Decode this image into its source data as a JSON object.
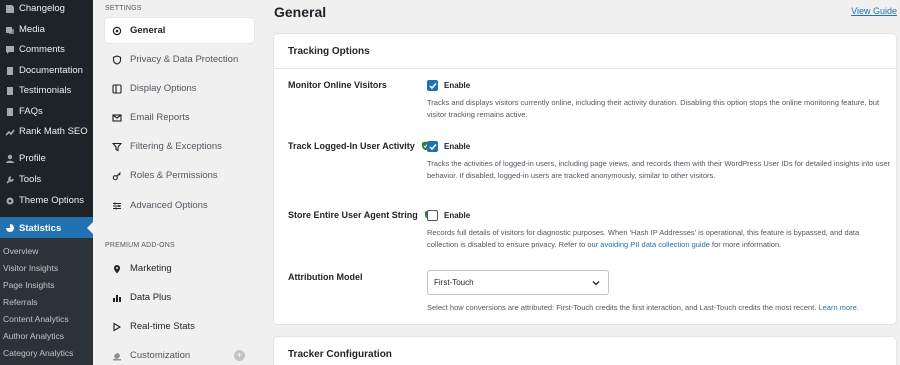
{
  "wp_menu": {
    "items": [
      {
        "label": "Changelog",
        "icon": "dashboard-icon"
      },
      {
        "label": "Media",
        "icon": "media-icon"
      },
      {
        "label": "Comments",
        "icon": "comments-icon"
      },
      {
        "label": "Documentation",
        "icon": "document-icon"
      },
      {
        "label": "Testimonials",
        "icon": "document-icon"
      },
      {
        "label": "FAQs",
        "icon": "document-icon"
      },
      {
        "label": "Rank Math SEO",
        "icon": "chart-icon"
      },
      {
        "label": "Profile",
        "icon": "user-icon"
      },
      {
        "label": "Tools",
        "icon": "wrench-icon"
      },
      {
        "label": "Theme Options",
        "icon": "gear-icon"
      },
      {
        "label": "Statistics",
        "icon": "pie-chart-icon"
      }
    ],
    "submenu": [
      "Overview",
      "Visitor Insights",
      "Page Insights",
      "Referrals",
      "Content Analytics",
      "Author Analytics",
      "Category Analytics"
    ]
  },
  "settings_nav": {
    "heading": "SETTINGS",
    "items": [
      {
        "label": "General",
        "icon": "gear-icon"
      },
      {
        "label": "Privacy & Data Protection",
        "icon": "shield-icon"
      },
      {
        "label": "Display Options",
        "icon": "layout-icon"
      },
      {
        "label": "Email Reports",
        "icon": "mail-icon"
      },
      {
        "label": "Filtering & Exceptions",
        "icon": "filter-icon"
      },
      {
        "label": "Roles & Permissions",
        "icon": "key-icon"
      },
      {
        "label": "Advanced Options",
        "icon": "sliders-icon"
      }
    ],
    "addons_heading": "PREMIUM ADD-ONS",
    "addons": [
      {
        "label": "Marketing",
        "icon": "pin-icon"
      },
      {
        "label": "Data Plus",
        "icon": "bar-chart-icon"
      },
      {
        "label": "Real-time Stats",
        "icon": "play-icon"
      },
      {
        "label": "Customization",
        "icon": "paint-icon"
      }
    ],
    "addon_badge": "+"
  },
  "main": {
    "title": "General",
    "view_guide": "View Guide",
    "tracking_card": {
      "title": "Tracking Options",
      "rows": {
        "monitor": {
          "label": "Monitor Online Visitors",
          "checkbox_label": "Enable",
          "checked": true,
          "desc": "Tracks and displays visitors currently online, including their activity duration. Disabling this option stops the online monitoring feature, but visitor tracking remains active."
        },
        "logged_in": {
          "label": "Track Logged-In User Activity",
          "checkbox_label": "Enable",
          "checked": true,
          "desc": "Tracks the activities of logged-in users, including page views, and records them with their WordPress User IDs for detailed insights into user behavior. If disabled, logged-in users are tracked anonymously, similar to other visitors."
        },
        "user_agent": {
          "label": "Store Entire User Agent String",
          "checkbox_label": "Enable",
          "checked": false,
          "desc_before": "Records full details of visitors for diagnostic purposes. When 'Hash IP Addresses' is operational, this feature is bypassed, and data collection is disabled to ensure privacy. Refer to our ",
          "desc_link": "avoiding PII data collection guide",
          "desc_after": " for more information."
        },
        "attribution": {
          "label": "Attribution Model",
          "selected": "First-Touch",
          "desc_before": "Select how conversions are attributed: First-Touch credits the first interaction, and Last-Touch credits the most recent. ",
          "desc_link": "Learn more."
        }
      }
    },
    "tracker_card": {
      "title": "Tracker Configuration"
    }
  },
  "colors": {
    "accent": "#2271b1",
    "sidebar_bg": "#1d2327",
    "shield_green": "#2e7d32"
  }
}
